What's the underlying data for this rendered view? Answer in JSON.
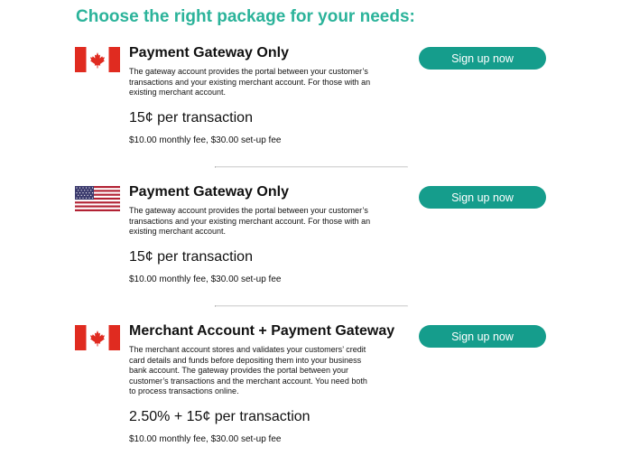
{
  "heading": "Choose the right package for your needs:",
  "packages": [
    {
      "flag": "canada-flag",
      "title": "Payment Gateway Only",
      "description": "The gateway account provides the portal between your customer’s transactions and your existing merchant account. For those with an existing merchant account.",
      "price": "15¢ per transaction",
      "fees": "$10.00 monthly fee, $30.00 set-up fee",
      "button": "Sign up now"
    },
    {
      "flag": "usa-flag",
      "title": "Payment Gateway Only",
      "description": "The gateway account provides the portal between your customer’s transactions and your existing merchant account. For those with an existing merchant account.",
      "price": "15¢ per transaction",
      "fees": "$10.00 monthly fee, $30.00 set-up fee",
      "button": "Sign up now"
    },
    {
      "flag": "canada-flag",
      "title": "Merchant Account + Payment Gateway",
      "description": "The merchant account stores and validates your customers’ credit card details and funds before depositing them into your business bank account. The gateway provides the portal between your customer’s transactions and the merchant account. You need both to process transactions online.",
      "price": "2.50% + 15¢ per transaction",
      "fees": "$10.00 monthly fee, $30.00 set-up fee",
      "button": "Sign up now"
    }
  ],
  "colors": {
    "heading": "#2bb39a",
    "button": "#159d8c",
    "canada_red": "#e02b20",
    "usa_red": "#b22234",
    "usa_blue": "#3c3b6e"
  }
}
